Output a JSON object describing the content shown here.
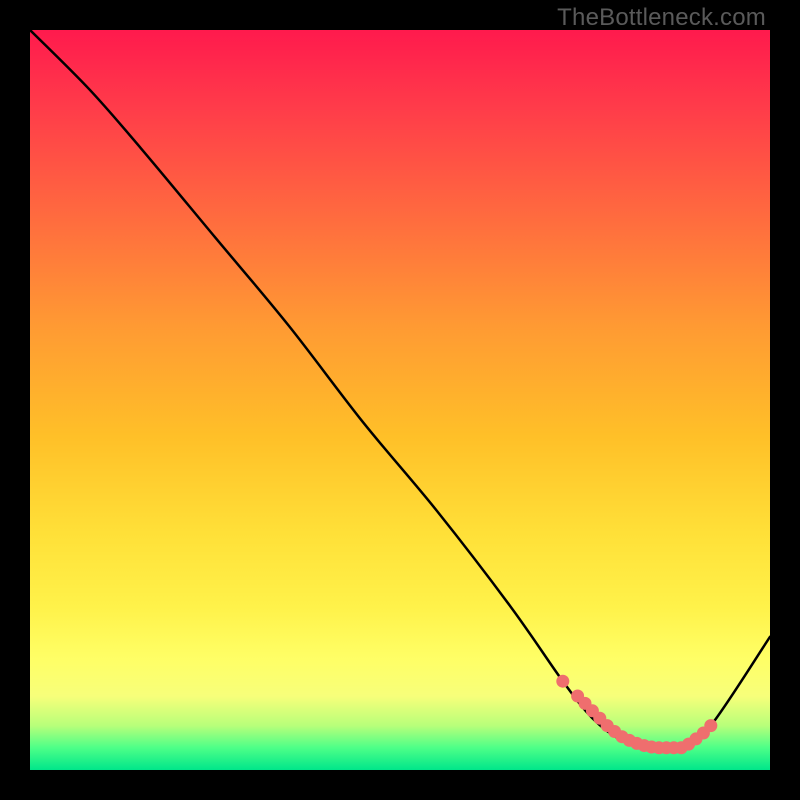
{
  "watermark": "TheBottleneck.com",
  "chart_data": {
    "type": "line",
    "title": "",
    "xlabel": "",
    "ylabel": "",
    "xlim": [
      0,
      100
    ],
    "ylim": [
      0,
      100
    ],
    "series": [
      {
        "name": "curve",
        "x": [
          0,
          8,
          15,
          25,
          35,
          45,
          55,
          65,
          72,
          76,
          80,
          84,
          88,
          92,
          100
        ],
        "y": [
          100,
          92,
          84,
          72,
          60,
          47,
          35,
          22,
          12,
          7,
          4,
          3,
          3,
          6,
          18
        ]
      }
    ],
    "highlight_points": {
      "x": [
        72,
        74,
        75,
        76,
        77,
        78,
        79,
        80,
        81,
        82,
        83,
        84,
        85,
        86,
        87,
        88,
        89,
        90,
        91,
        92
      ],
      "y": [
        12,
        10,
        9,
        8,
        7,
        6,
        5.2,
        4.5,
        4,
        3.6,
        3.3,
        3.1,
        3.0,
        3.0,
        3.0,
        3.0,
        3.5,
        4.2,
        5.0,
        6.0
      ]
    },
    "colors": {
      "curve": "#000000",
      "highlight": "#ef6e6e"
    }
  }
}
